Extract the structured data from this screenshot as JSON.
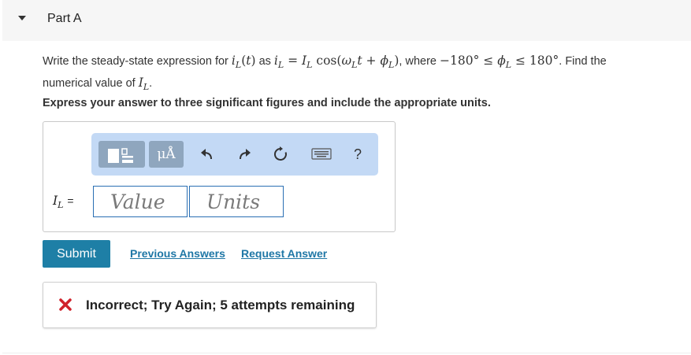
{
  "part": {
    "title": "Part A"
  },
  "question": {
    "lead": "Write the steady-state expression for ",
    "as": " as ",
    "where": ", where ",
    "find": ". Find the",
    "line2": "numerical value of ",
    "line2_end": "."
  },
  "instruction": "Express your answer to three significant figures and include the appropriate units.",
  "toolbar": {
    "units_label": "μÅ",
    "help_label": "?",
    "icons": [
      "templates-icon",
      "units-icon",
      "undo-icon",
      "redo-icon",
      "reset-icon",
      "keyboard-icon",
      "help-icon"
    ]
  },
  "answer": {
    "label": "= ",
    "value_placeholder": "Value",
    "units_placeholder": "Units"
  },
  "actions": {
    "submit": "Submit",
    "previous_answers": "Previous Answers",
    "request_answer": "Request Answer"
  },
  "feedback": {
    "text": "Incorrect; Try Again; 5 attempts remaining",
    "icon_color": "#d0222b"
  },
  "colors": {
    "submit_bg": "#1e7fa6",
    "link": "#1f77a6",
    "toolbar_bg": "#c3d9f5",
    "field_border": "#2a6fb3"
  }
}
